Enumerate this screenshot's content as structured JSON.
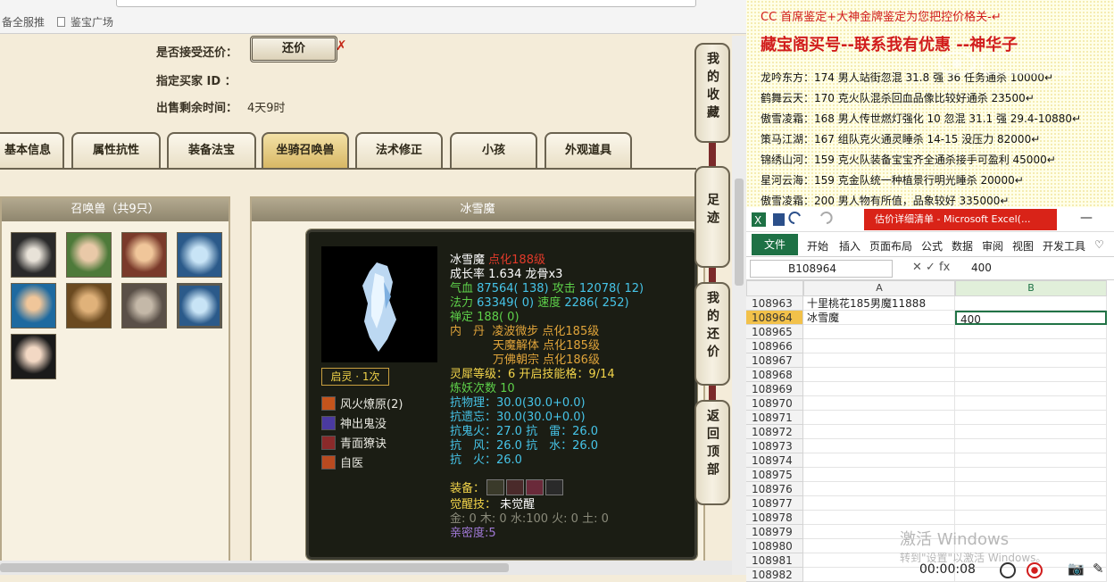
{
  "browser": {
    "bookmarks": [
      "备全服推",
      "鉴宝广场"
    ]
  },
  "trade": {
    "accept_counter_label": "是否接受还价：",
    "counter_button": "还价",
    "buyer_id_label": "指定买家 ID ：",
    "time_left_label": "出售剩余时间：",
    "time_left_value": "4天9时"
  },
  "tabs": [
    "基本信息",
    "属性抗性",
    "装备法宝",
    "坐骑召唤兽",
    "法术修正",
    "小孩",
    "外观道具"
  ],
  "pets_panel": {
    "header": "召唤兽（共9只）"
  },
  "detail": {
    "header": "冰雪魔",
    "name": "冰雪魔",
    "name_suffix": "点化188级",
    "growth": "成长率 1.634 龙骨x3",
    "hp_label": "气血",
    "hp_value": "87564( 138)",
    "atk_label": "攻击",
    "atk_value": "12078( 12)",
    "mp_label": "法力",
    "mp_value": "63349( 0)",
    "spd_label": "速度",
    "spd_value": "2286( 252)",
    "zen_label": "禅定",
    "zen_value": "188( 0)",
    "elixir_label": "内　丹",
    "elixir_1": "凌波微步 点化185级",
    "elixir_2": "天魔解体 点化185级",
    "elixir_3": "万佛朝宗 点化186级",
    "spirit_line": "灵犀等级：6 开启技能格：9/14",
    "refine_line": "炼妖次数 10",
    "resist_1": "抗物理：30.0(30.0+0.0)",
    "resist_2": "抗遗忘：30.0(30.0+0.0)",
    "resist_3": "抗鬼火：27.0 抗　雷：26.0",
    "resist_4": "抗　风：26.0 抗　水：26.0",
    "resist_5": "抗　火：26.0",
    "equip_label": "装备：",
    "awaken_label": "觉醒技：",
    "awaken_value": "未觉醒",
    "elements": "金: 0 木: 0 水:100 火: 0 土: 0",
    "intimacy": "亲密度:5",
    "awaken_tag": "启灵 · 1次",
    "skills": [
      "风火燎原(2)",
      "神出鬼没",
      "青面獠诀",
      "自医"
    ]
  },
  "side_buttons": [
    "我的收藏",
    "足迹",
    "我的还价",
    "返回顶部"
  ],
  "notes": {
    "title1": "CC 首席鉴定+大神金牌鉴定为您把控价格关-↵",
    "title2": "藏宝阁买号--联系我有优惠 --神华子",
    "rows": [
      "龙吟东方：174 男人站街忽混 31.8 强 36 任务通杀 10000↵",
      "鹤舞云天：170 克火队混杀回血品像比较好通杀 23500↵",
      "傲雪凌霜：168 男人传世燃灯强化 10 忽混 31.1 强 29.4-10880↵",
      "策马江湖：167 组队克火通灵睡杀 14-15 没压力 82000↵",
      "锦绣山河：159 克火队装备宝宝齐全通杀接手可盈利 45000↵",
      "星河云海：159 克金队统一种植景行明光睡杀 20000↵",
      "傲雪凌霜：200 男人物有所值，品象较好 335000↵"
    ]
  },
  "excel": {
    "title": "估价详细清单 - Microsoft Excel(...",
    "file_tab": "文件",
    "menus": [
      "开始",
      "插入",
      "页面布局",
      "公式",
      "数据",
      "审阅",
      "视图",
      "开发工具"
    ],
    "name_box": "B108964",
    "formula_value": "400",
    "col_a": "A",
    "col_b": "B",
    "rows": [
      {
        "num": "108963",
        "a": "十里桃花185男魔11888",
        "b": ""
      },
      {
        "num": "108964",
        "a": "冰雪魔",
        "b": "400"
      },
      {
        "num": "108965",
        "a": "",
        "b": ""
      },
      {
        "num": "108966",
        "a": "",
        "b": ""
      },
      {
        "num": "108967",
        "a": "",
        "b": ""
      },
      {
        "num": "108968",
        "a": "",
        "b": ""
      },
      {
        "num": "108969",
        "a": "",
        "b": ""
      },
      {
        "num": "108970",
        "a": "",
        "b": ""
      },
      {
        "num": "108971",
        "a": "",
        "b": ""
      },
      {
        "num": "108972",
        "a": "",
        "b": ""
      },
      {
        "num": "108973",
        "a": "",
        "b": ""
      },
      {
        "num": "108974",
        "a": "",
        "b": ""
      },
      {
        "num": "108975",
        "a": "",
        "b": ""
      },
      {
        "num": "108976",
        "a": "",
        "b": ""
      },
      {
        "num": "108977",
        "a": "",
        "b": ""
      },
      {
        "num": "108978",
        "a": "",
        "b": ""
      },
      {
        "num": "108979",
        "a": "",
        "b": ""
      },
      {
        "num": "108980",
        "a": "",
        "b": ""
      },
      {
        "num": "108981",
        "a": "",
        "b": ""
      },
      {
        "num": "108982",
        "a": "",
        "b": ""
      }
    ]
  },
  "os": {
    "activate_1": "激活 Windows",
    "activate_2": "转到\"设置\"以激活 Windows。"
  },
  "recorder": {
    "timer": "00:00:08"
  },
  "colors": {
    "excel_green": "#1e7145",
    "title_red": "#d92318",
    "accent_gold": "#f2d44a"
  }
}
